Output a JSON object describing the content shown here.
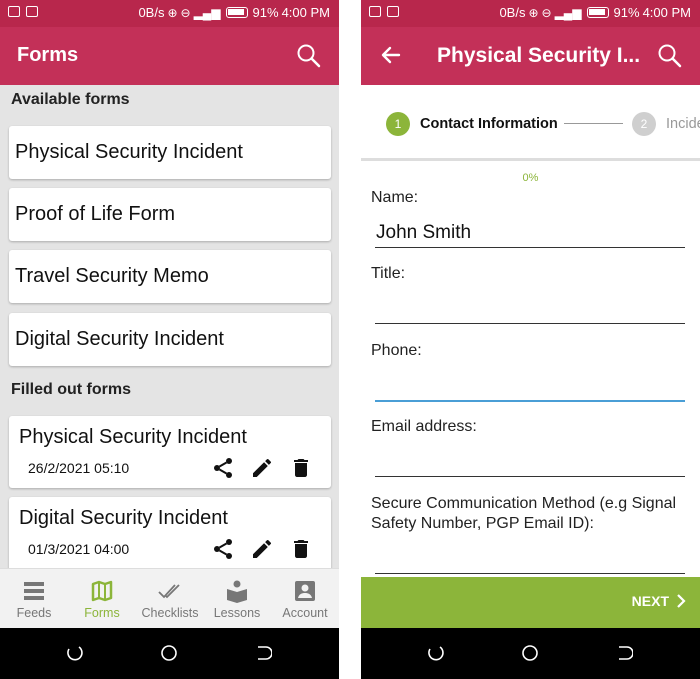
{
  "status": {
    "speed": "0B/s",
    "battery": "91%",
    "time": "4:00 PM"
  },
  "left": {
    "title": "Forms",
    "available_header": "Available forms",
    "available": [
      {
        "label": "Physical Security Incident"
      },
      {
        "label": "Proof of Life Form"
      },
      {
        "label": "Travel Security Memo"
      },
      {
        "label": "Digital Security Incident"
      }
    ],
    "filled_header": "Filled out forms",
    "filled": [
      {
        "label": "Physical Security Incident",
        "date": "26/2/2021 05:10"
      },
      {
        "label": "Digital Security Incident",
        "date": "01/3/2021 04:00"
      }
    ],
    "nav": [
      {
        "label": "Feeds",
        "icon": "feeds-icon"
      },
      {
        "label": "Forms",
        "icon": "map-icon"
      },
      {
        "label": "Checklists",
        "icon": "checkmarks-icon"
      },
      {
        "label": "Lessons",
        "icon": "lessons-icon"
      },
      {
        "label": "Account",
        "icon": "account-icon"
      }
    ],
    "nav_active": "Forms"
  },
  "right": {
    "title": "Physical Security I...",
    "steps": [
      {
        "number": "1",
        "label": "Contact Information"
      },
      {
        "number": "2",
        "label": "Incide"
      }
    ],
    "progress": "0%",
    "fields": [
      {
        "label": "Name:",
        "value": "John Smith"
      },
      {
        "label": "Title:",
        "value": ""
      },
      {
        "label": "Phone:",
        "value": ""
      },
      {
        "label": "Email address:",
        "value": ""
      },
      {
        "label": "Secure Communication Method (e.g Signal Safety Number, PGP Email ID):",
        "value": ""
      }
    ],
    "next_label": "NEXT"
  },
  "colors": {
    "brand": "#c33058",
    "status_bar": "#b8274c",
    "accent": "#8cb53a",
    "focus": "#4a9ed6"
  }
}
